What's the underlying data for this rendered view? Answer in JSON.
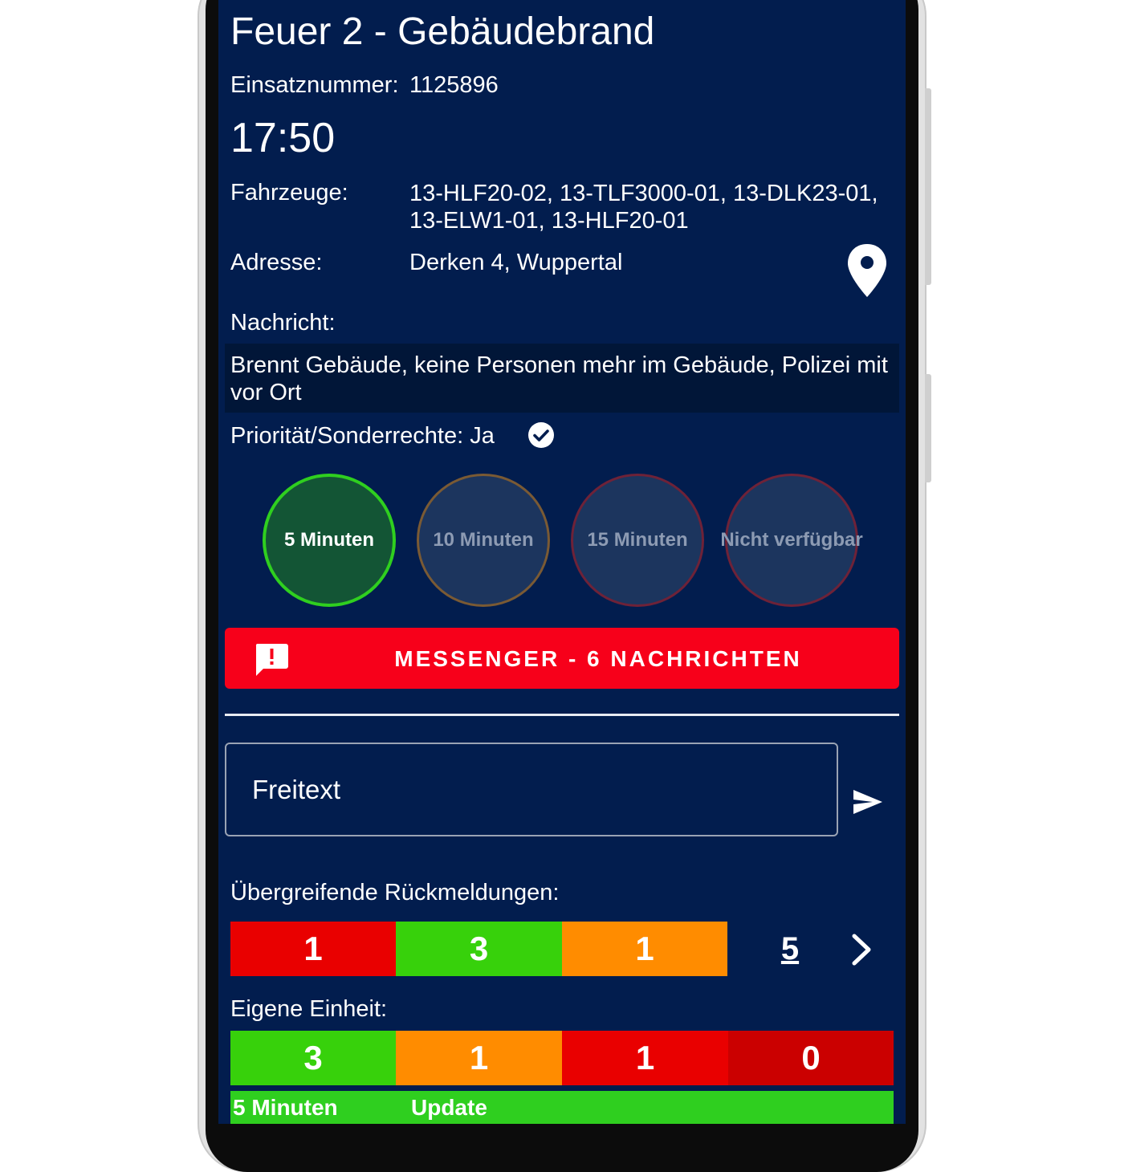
{
  "header": {
    "title": "Feuer 2 - Gebäudebrand",
    "einsatznummer_label": "Einsatznummer:",
    "einsatznummer_value": "1125896",
    "time": "17:50"
  },
  "details": {
    "fahrzeuge_label": "Fahrzeuge:",
    "fahrzeuge_line1": "13-HLF20-02, 13-TLF3000-01, 13-DLK23-01,",
    "fahrzeuge_line2": "13-ELW1-01, 13-HLF20-01",
    "adresse_label": "Adresse:",
    "adresse_value": "Derken 4, Wuppertal",
    "map_icon": "map-pin-icon",
    "nachricht_label": "Nachricht:",
    "nachricht_text": "Brennt Gebäude, keine Personen mehr im Gebäude, Polizei mit vor Ort",
    "prioritaet_label": "Priorität/Sonderrechte: Ja",
    "prioritaet_icon": "check-circle-icon"
  },
  "eta_options": [
    {
      "label": "5 Minuten",
      "selected": true
    },
    {
      "label": "10 Minuten",
      "selected": false
    },
    {
      "label": "15 Minuten",
      "selected": false
    },
    {
      "label": "Nicht verfügbar",
      "selected": false
    }
  ],
  "messenger": {
    "label": "MESSENGER - 6 NACHRICHTEN",
    "icon": "message-alert-icon"
  },
  "freitext": {
    "placeholder": "Freitext",
    "send_icon": "send-icon"
  },
  "uebergreifend": {
    "label": "Übergreifende Rückmeldungen:",
    "counts": [
      "1",
      "3",
      "1"
    ],
    "total": "5",
    "chevron_icon": "chevron-right-icon"
  },
  "eigene": {
    "label": "Eigene Einheit:",
    "counts": [
      "3",
      "1",
      "1",
      "0"
    ]
  },
  "status": {
    "eta": "5 Minuten",
    "update": "Update"
  },
  "colors": {
    "background": "#021d4e",
    "red": "#e90000",
    "green": "#37d10b",
    "orange": "#ff8c00",
    "dark_red": "#cb0000",
    "messenger_red": "#f7001a"
  }
}
